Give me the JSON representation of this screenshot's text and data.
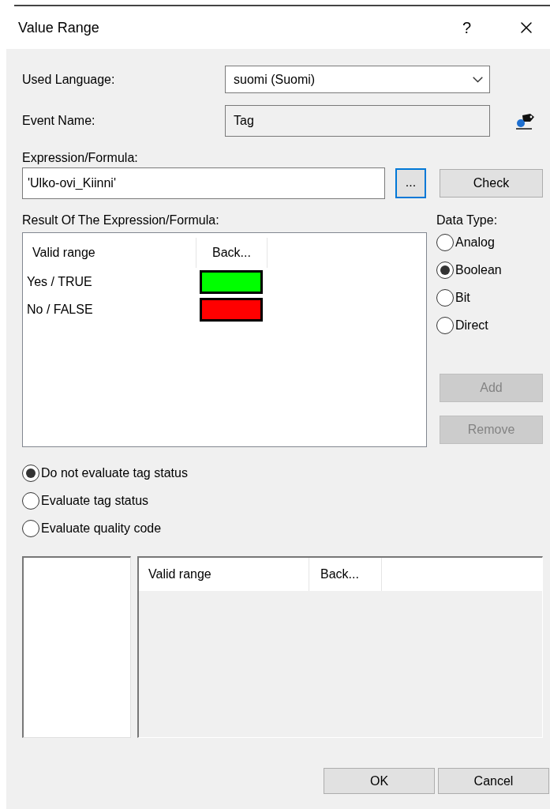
{
  "window": {
    "title": "Value Range",
    "help": "?"
  },
  "used_language": {
    "label": "Used Language:",
    "value": "suomi (Suomi)"
  },
  "event_name": {
    "label": "Event Name:",
    "value": "Tag",
    "disabled": true
  },
  "expression": {
    "label": "Expression/Formula:",
    "value": "'Ulko-ovi_Kiinni'",
    "browse": "...",
    "check": "Check"
  },
  "result": {
    "label": "Result Of The Expression/Formula:",
    "columns": [
      "Valid range",
      "Back..."
    ],
    "rows": [
      {
        "range": "Yes / TRUE",
        "color": "#00ff00"
      },
      {
        "range": "No / FALSE",
        "color": "#ff0000"
      }
    ]
  },
  "data_type": {
    "label": "Data Type:",
    "options": [
      {
        "label": "Analog",
        "selected": false
      },
      {
        "label": "Boolean",
        "selected": true
      },
      {
        "label": "Bit",
        "selected": false
      },
      {
        "label": "Direct",
        "selected": false
      }
    ]
  },
  "side_buttons": [
    {
      "label": "Add",
      "disabled": true
    },
    {
      "label": "Remove",
      "disabled": true
    }
  ],
  "evaluation": [
    {
      "label": "Do not evaluate tag status",
      "selected": true
    },
    {
      "label": "Evaluate tag status",
      "selected": false
    },
    {
      "label": "Evaluate quality code",
      "selected": false
    }
  ],
  "status_table": {
    "columns": [
      "Valid range",
      "Back..."
    ]
  },
  "footer_buttons": [
    "OK",
    "Cancel"
  ]
}
